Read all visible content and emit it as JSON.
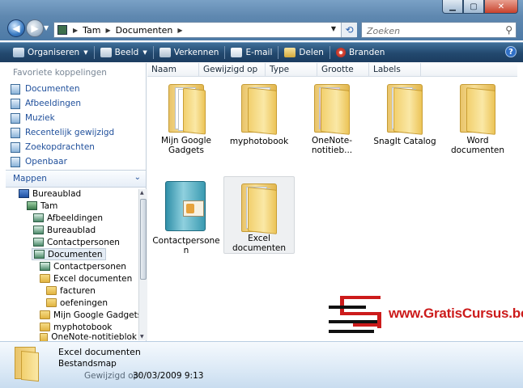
{
  "address": {
    "segments": [
      "Tam",
      "Documenten"
    ]
  },
  "search": {
    "placeholder": "Zoeken"
  },
  "toolbar": {
    "organize": "Organiseren",
    "view": "Beeld",
    "explore": "Verkennen",
    "email": "E-mail",
    "share": "Delen",
    "burn": "Branden"
  },
  "favorites": {
    "title": "Favoriete koppelingen",
    "items": [
      "Documenten",
      "Afbeeldingen",
      "Muziek",
      "Recentelijk gewijzigd",
      "Zoekopdrachten",
      "Openbaar"
    ]
  },
  "folders": {
    "title": "Mappen",
    "tree": [
      "Bureaublad",
      "Tam",
      "Afbeeldingen",
      "Bureaublad",
      "Contactpersonen",
      "Documenten",
      "Contactpersonen",
      "Excel documenten",
      "facturen",
      "oefeningen",
      "Mijn Google Gadgets",
      "myphotobook",
      "OneNote-notitieblok"
    ]
  },
  "columns": [
    "Naam",
    "Gewijzigd op",
    "Type",
    "Grootte",
    "Labels"
  ],
  "items": [
    "Mijn Google Gadgets",
    "myphotobook",
    "OneNote-notitieb...",
    "SnagIt Catalog",
    "Word documenten",
    "Contactpersonen",
    "Excel documenten"
  ],
  "details": {
    "name": "Excel documenten",
    "type": "Bestandsmap",
    "modified_label": "Gewijzigd op:",
    "modified_value": "30/03/2009 9:13"
  },
  "watermark": {
    "text": "www.GratisCursus.be"
  },
  "colors": {
    "link": "#1f4f9b",
    "watermark": "#cc1b1b",
    "cmdbar": "#22486e"
  }
}
